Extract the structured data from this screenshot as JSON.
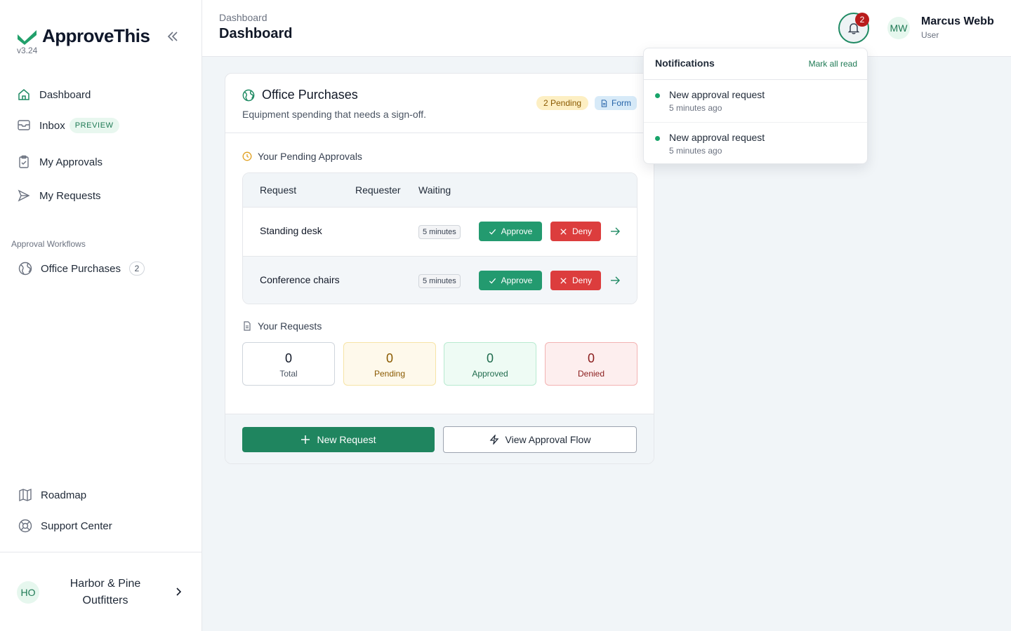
{
  "app": {
    "name": "ApproveThis",
    "version": "v3.24"
  },
  "sidebar": {
    "nav": [
      {
        "label": "Dashboard",
        "icon": "home-icon"
      },
      {
        "label": "Inbox",
        "icon": "inbox-icon",
        "badge": "PREVIEW"
      },
      {
        "label": "My Approvals",
        "icon": "clipboard-icon"
      },
      {
        "label": "My Requests",
        "icon": "send-icon"
      }
    ],
    "section_label": "Approval Workflows",
    "workflows": [
      {
        "label": "Office Purchases",
        "count": "2",
        "icon": "globe-icon"
      }
    ],
    "bottom": [
      {
        "label": "Roadmap",
        "icon": "map-icon"
      },
      {
        "label": "Support Center",
        "icon": "lifebuoy-icon"
      }
    ],
    "org": {
      "initials": "HO",
      "name": "Harbor & Pine Outfitters"
    }
  },
  "header": {
    "breadcrumb": "Dashboard",
    "title": "Dashboard",
    "notification_count": "2",
    "user": {
      "initials": "MW",
      "name": "Marcus Webb",
      "role": "User"
    }
  },
  "notifications": {
    "title": "Notifications",
    "mark_all": "Mark all read",
    "items": [
      {
        "text": "New approval request",
        "time": "5 minutes ago"
      },
      {
        "text": "New approval request",
        "time": "5 minutes ago"
      }
    ]
  },
  "workflow_card": {
    "title": "Office Purchases",
    "subtitle": "Equipment spending that needs a sign-off.",
    "pending_badge": "2 Pending",
    "form_badge": "Form",
    "pending_section": "Your Pending Approvals",
    "columns": [
      "Request",
      "Requester",
      "Waiting"
    ],
    "rows": [
      {
        "request": "Standing desk",
        "requester": "",
        "waiting": "5 minutes"
      },
      {
        "request": "Conference chairs",
        "requester": "",
        "waiting": "5 minutes"
      }
    ],
    "approve_label": "Approve",
    "deny_label": "Deny",
    "requests_section": "Your Requests",
    "stats": [
      {
        "value": "0",
        "label": "Total"
      },
      {
        "value": "0",
        "label": "Pending"
      },
      {
        "value": "0",
        "label": "Approved"
      },
      {
        "value": "0",
        "label": "Denied"
      }
    ],
    "new_request": "New Request",
    "view_flow": "View Approval Flow"
  },
  "colors": {
    "brand": "#1f855f",
    "approve": "#239a6f",
    "deny": "#dc3d3d",
    "notification_badge": "#b91c1c"
  }
}
